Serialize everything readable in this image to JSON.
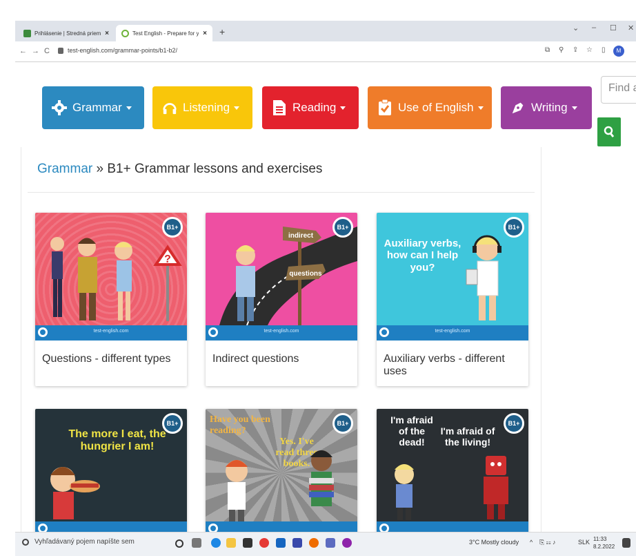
{
  "browser": {
    "tabs": [
      {
        "title": "Prihlásenie | Stredná priemyseln"
      },
      {
        "title": "Test English - Prepare for your E"
      }
    ],
    "new_tab": "+",
    "url": "test-english.com/grammar-points/b1-b2/"
  },
  "nav": {
    "grammar": "Grammar",
    "listening": "Listening",
    "reading": "Reading",
    "use_of_english": "Use of English",
    "writing": "Writing",
    "search_placeholder": "Find a"
  },
  "breadcrumb": {
    "link": "Grammar",
    "separator": " » ",
    "current": "B1+ Grammar lessons and exercises"
  },
  "cards": [
    {
      "caption": "Questions - different types",
      "badge": "B1+",
      "site": "test-english.com"
    },
    {
      "caption": "Indirect questions",
      "badge": "B1+",
      "site": "test-english.com",
      "sign1": "indirect",
      "sign2": "questions"
    },
    {
      "caption": "Auxiliary verbs - different uses",
      "badge": "B1+",
      "site": "test-english.com",
      "overlay": "Auxiliary verbs, how can I help you?"
    },
    {
      "caption": "",
      "badge": "B1+",
      "overlay": "The more I eat, the hungrier I am!"
    },
    {
      "caption": "",
      "badge": "B1+",
      "overlay1": "Have you been reading?",
      "overlay2": "Yes. I've read three books."
    },
    {
      "caption": "",
      "badge": "B1+",
      "overlay1": "I'm afraid of the dead!",
      "overlay2": "I'm afraid of the living!"
    }
  ],
  "taskbar": {
    "search_placeholder": "Vyhľadávaný pojem napíšte sem",
    "weather": "3°C Mostly cloudy",
    "lang": "SLK",
    "time": "11:33",
    "date": "8.2.2022"
  }
}
